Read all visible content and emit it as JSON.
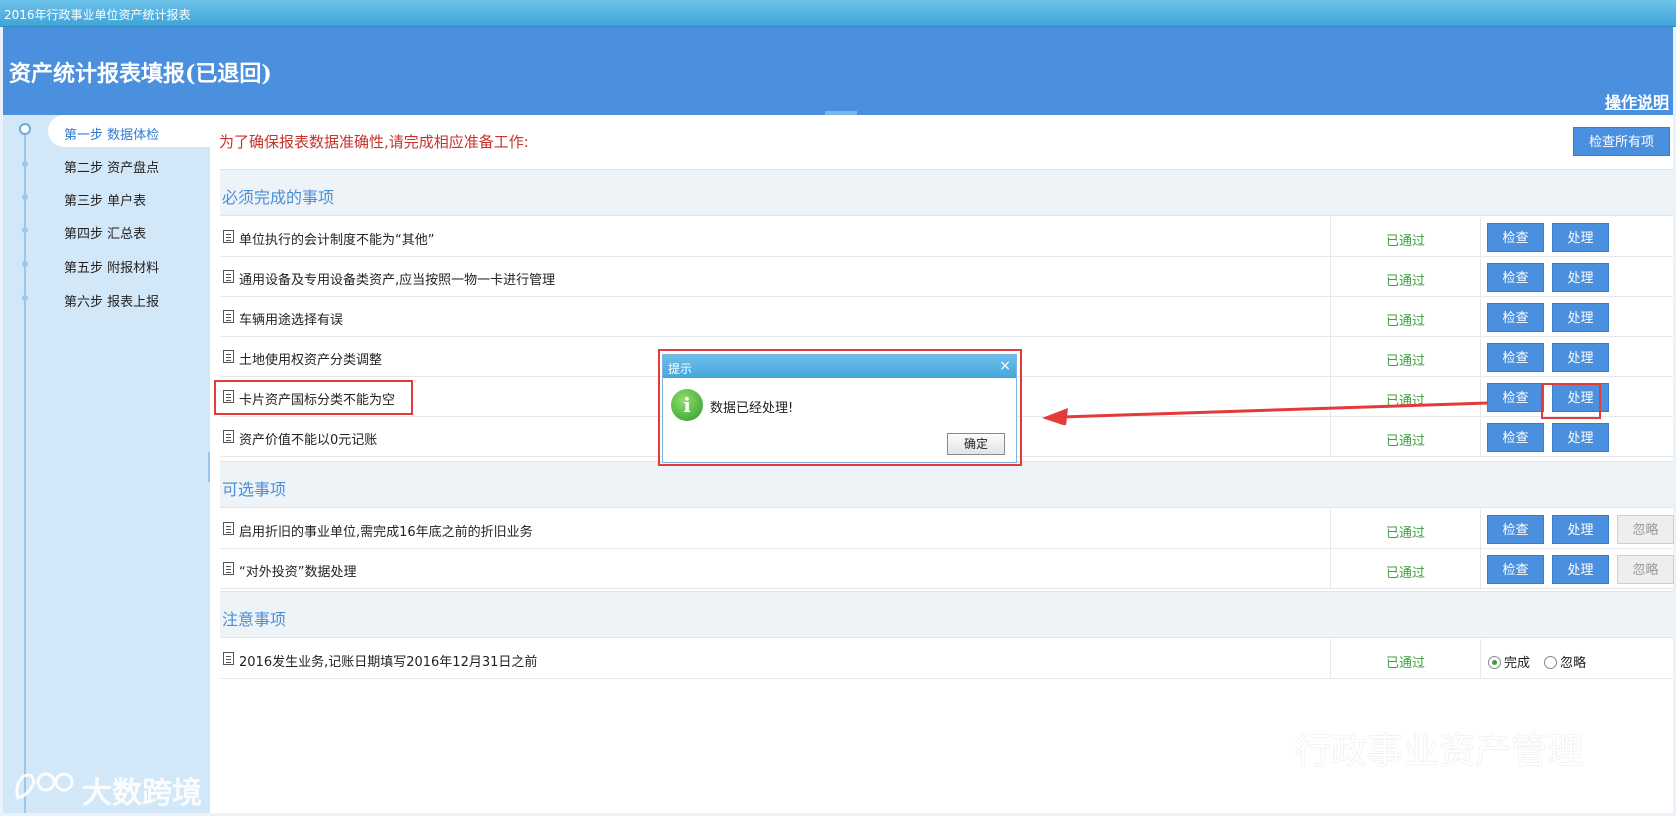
{
  "window": {
    "title": "2016年行政事业单位资产统计报表"
  },
  "header": {
    "title": "资产统计报表填报(已退回)",
    "help_link": "操作说明"
  },
  "sidebar": {
    "steps": [
      {
        "label": "第一步 数据体检",
        "active": true
      },
      {
        "label": "第二步 资产盘点",
        "active": false
      },
      {
        "label": "第三步 单户表",
        "active": false
      },
      {
        "label": "第四步 汇总表",
        "active": false
      },
      {
        "label": "第五步 附报材料",
        "active": false
      },
      {
        "label": "第六步 报表上报",
        "active": false
      }
    ]
  },
  "main": {
    "notice": "为了确保报表数据准确性,请完成相应准备工作:",
    "check_all_label": "检查所有项",
    "sections": [
      {
        "title": "必须完成的事项",
        "items": [
          {
            "label": "单位执行的会计制度不能为“其他”",
            "status": "已通过",
            "check": "检查",
            "process": "处理"
          },
          {
            "label": "通用设备及专用设备类资产,应当按照一物一卡进行管理",
            "status": "已通过",
            "check": "检查",
            "process": "处理"
          },
          {
            "label": "车辆用途选择有误",
            "status": "已通过",
            "check": "检查",
            "process": "处理"
          },
          {
            "label": "土地使用权资产分类调整",
            "status": "已通过",
            "check": "检查",
            "process": "处理"
          },
          {
            "label": "卡片资产国标分类不能为空",
            "status": "已通过",
            "check": "检查",
            "process": "处理"
          },
          {
            "label": "资产价值不能以0元记账",
            "status": "已通过",
            "check": "检查",
            "process": "处理"
          }
        ]
      },
      {
        "title": "可选事项",
        "items": [
          {
            "label": "启用折旧的事业单位,需完成16年底之前的折旧业务",
            "status": "已通过",
            "check": "检查",
            "process": "处理",
            "ignore": "忽略"
          },
          {
            "label": "“对外投资”数据处理",
            "status": "已通过",
            "check": "检查",
            "process": "处理",
            "ignore": "忽略"
          }
        ]
      },
      {
        "title": "注意事项",
        "items": [
          {
            "label": "2016发生业务,记账日期填写2016年12月31日之前",
            "status": "已通过",
            "radio_done": "完成",
            "radio_ignore": "忽略",
            "selected": "完成"
          }
        ]
      }
    ]
  },
  "dialog": {
    "title": "提示",
    "close": "×",
    "icon": "info-icon",
    "message": "数据已经处理!",
    "ok_label": "确定"
  },
  "watermarks": {
    "left": "大数跨境",
    "right": "行政事业资产管理"
  },
  "colors": {
    "header_bg": "#4b90de",
    "button_bg": "#4b90de",
    "status_green": "#3aa23a",
    "notice_red": "#c7332b",
    "annotation_red": "#e33a3a"
  }
}
